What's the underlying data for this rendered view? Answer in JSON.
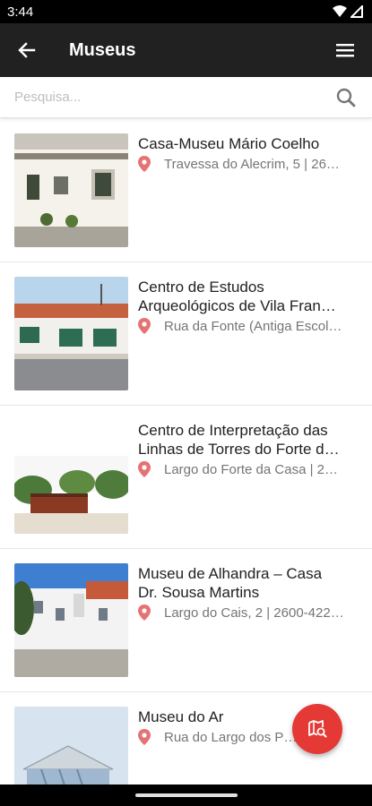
{
  "status": {
    "time": "3:44"
  },
  "app_bar": {
    "title": "Museus"
  },
  "search": {
    "placeholder": "Pesquisa..."
  },
  "museums": [
    {
      "name_line1": "Casa-Museu Mário Coelho",
      "name_line2": "",
      "address": "Travessa do Alecrim, 5 | 26…"
    },
    {
      "name_line1": "Centro de Estudos",
      "name_line2": "Arqueológicos de Vila Fran…",
      "address": "Rua da Fonte (Antiga Escol…"
    },
    {
      "name_line1": "Centro de Interpretação das",
      "name_line2": "Linhas de Torres do Forte d…",
      "address": "Largo do Forte da Casa | 2…"
    },
    {
      "name_line1": "Museu de Alhandra – Casa",
      "name_line2": "Dr. Sousa Martins",
      "address": "Largo do Cais, 2 | 2600-422…"
    },
    {
      "name_line1": "Museu do Ar",
      "name_line2": "",
      "address": "Rua do Largo dos P…"
    }
  ],
  "colors": {
    "app_bar": "#212121",
    "accent": "#e53935",
    "pin": "#e57373"
  },
  "icons": {
    "back": "arrow-left-icon",
    "menu": "hamburger-menu-icon",
    "search": "search-icon",
    "pin": "map-pin-icon",
    "fab": "map-search-icon"
  }
}
